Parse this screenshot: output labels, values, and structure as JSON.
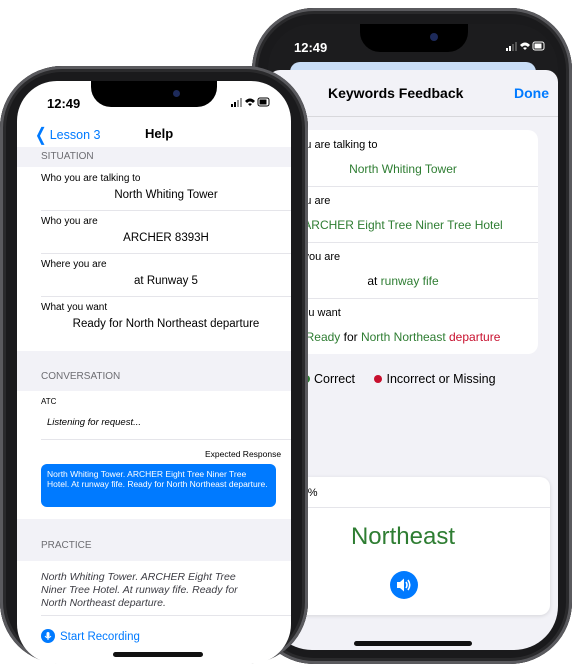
{
  "back_phone": {
    "status_time": "12:49",
    "title": "Keywords Feedback",
    "done_label": "Done",
    "rows": [
      {
        "label": "Who you are talking to",
        "parts": [
          {
            "text": "North Whiting Tower",
            "color": "#2e7d32"
          }
        ]
      },
      {
        "label": "Who you are",
        "parts": [
          {
            "text": "ARCHER Eight Tree Niner Tree Hotel",
            "color": "#2e7d32"
          }
        ]
      },
      {
        "label": "Where you are",
        "parts": [
          {
            "text": "at ",
            "color": "#000000"
          },
          {
            "text": "runway fife",
            "color": "#2e7d32"
          }
        ]
      },
      {
        "label": "What you want",
        "parts": [
          {
            "text": "Ready",
            "color": "#2e7d32"
          },
          {
            "text": " for ",
            "color": "#000000"
          },
          {
            "text": "North Northeast",
            "color": "#2e7d32"
          },
          {
            "text": " departure",
            "color": "#c8102e"
          }
        ]
      }
    ],
    "legend": {
      "correct": "Correct",
      "incorrect": "Incorrect or Missing",
      "correct_color": "#2e7d32",
      "incorrect_color": "#c8102e"
    },
    "score_label": "core: 93%",
    "score_word": "Northeast",
    "speaker_icon": "speaker-icon"
  },
  "front_phone": {
    "status_time": "12:49",
    "back_label": "Lesson 3",
    "title": "Help",
    "situation_header": "SITUATION",
    "fields": [
      {
        "label": "Who you are talking to",
        "value": "North Whiting Tower"
      },
      {
        "label": "Who you are",
        "value": "ARCHER 8393H"
      },
      {
        "label": "Where you are",
        "value": "at Runway 5"
      },
      {
        "label": "What you want",
        "value": "Ready for North Northeast departure"
      }
    ],
    "conversation_header": "CONVERSATION",
    "atc_label": "ATC",
    "listening": "Listening for request...",
    "expected_label": "Expected Response",
    "expected_text": "North Whiting Tower. ARCHER Eight Tree Niner Tree Hotel. At runway fife. Ready for North Northeast departure.",
    "practice_header": "PRACTICE",
    "practice_text": "North Whiting Tower. ARCHER Eight Tree Niner Tree Hotel. At runway fife. Ready for North Northeast departure.",
    "start_recording": "Start Recording",
    "accent_color": "#007aff"
  }
}
